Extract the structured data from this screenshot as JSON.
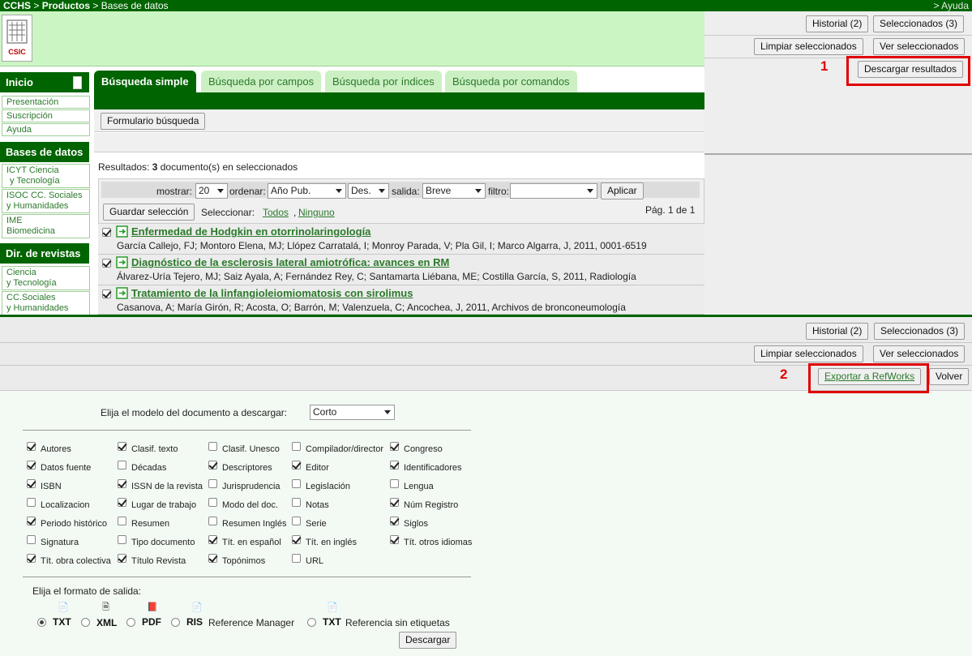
{
  "topbar": {
    "crumb_home": "CCHS",
    "crumb_sep1": ">",
    "crumb_products": "Productos",
    "crumb_sep2": ">",
    "crumb_db": "Bases de datos",
    "help": "> Ayuda"
  },
  "logo": {
    "text": "CSIC"
  },
  "top_buttons": {
    "historial": "Historial (2)",
    "seleccionados": "Seleccionados (3)",
    "limpiar": "Limpiar seleccionados",
    "ver": "Ver seleccionados",
    "descargar": "Descargar resultados"
  },
  "markers": {
    "one": "1",
    "two": "2"
  },
  "sidebar": {
    "inicio": "Inicio",
    "inicio_links": [
      "Presentación",
      "Suscripción",
      "Ayuda"
    ],
    "bases": "Bases de datos",
    "bases_links": [
      [
        "ICYT Ciencia",
        "y Tecnología"
      ],
      [
        "ISOC CC. Sociales",
        "y Humanidades"
      ],
      [
        "IME",
        "Biomedicina"
      ]
    ],
    "revistas": "Dir. de revistas",
    "revistas_links": [
      [
        "Ciencia",
        "y Tecnología"
      ],
      [
        "CC.Sociales",
        "y Humanidades"
      ]
    ]
  },
  "tabs": [
    "Búsqueda simple",
    "Búsqueda por campos",
    "Búsqueda por índices",
    "Búsqueda por comandos"
  ],
  "form_button": "Formulario búsqueda",
  "results": {
    "prefix": "Resultados:",
    "count": "3",
    "suffix": "documento(s) en seleccionados"
  },
  "controls": {
    "mostrar_label": "mostrar:",
    "mostrar_value": "20",
    "ordenar_label": "ordenar:",
    "ordenar_value": "Año Pub.",
    "order_dir": "Des.",
    "salida_label": "salida:",
    "salida_value": "Breve",
    "filtro_label": "filtro:",
    "filtro_value": "",
    "aplicar": "Aplicar",
    "guardar": "Guardar selección",
    "seleccionar": "Seleccionar:",
    "todos": "Todos",
    "ninguno": "Ninguno",
    "pagina": "Pág. 1 de 1"
  },
  "documents": [
    {
      "title": "Enfermedad de Hodgkin en otorrinolaringología",
      "authors": "García Callejo, FJ; Montoro Elena, MJ; Llópez Carratalá, I; Monroy Parada, V; Pla Gil, I; Marco Algarra, J,  2011,  0001-6519"
    },
    {
      "title": "Diagnóstico de la esclerosis lateral amiotrófica: avances en RM",
      "authors": "Álvarez-Uría Tejero, MJ; Saiz Ayala, A; Fernández Rey, C; Santamarta Liébana, ME; Costilla García, S,  2011,  Radiología"
    },
    {
      "title": "Tratamiento de la linfangioleiomiomatosis con sirolimus",
      "authors": "Casanova, A; María Girón, R; Acosta, O; Barrón, M; Valenzuela, C; Ancochea, J,  2011,  Archivos de bronconeumología"
    }
  ],
  "bottom_buttons": {
    "historial": "Historial (2)",
    "seleccionados": "Seleccionados (3)",
    "limpiar": "Limpiar seleccionados",
    "ver": "Ver seleccionados",
    "exportar": "Exportar a RefWorks",
    "volver": "Volver"
  },
  "download": {
    "model_label": "Elija el modelo del documento a descargar:",
    "model_value": "Corto",
    "fields": [
      [
        {
          "label": "Autores",
          "checked": true
        },
        {
          "label": "Clasif. texto",
          "checked": true
        },
        {
          "label": "Clasif. Unesco",
          "checked": false
        },
        {
          "label": "Compilador/director",
          "checked": false
        },
        {
          "label": "Congreso",
          "checked": true
        }
      ],
      [
        {
          "label": "Datos fuente",
          "checked": true
        },
        {
          "label": "Décadas",
          "checked": false
        },
        {
          "label": "Descriptores",
          "checked": true
        },
        {
          "label": "Editor",
          "checked": true
        },
        {
          "label": "Identificadores",
          "checked": true
        }
      ],
      [
        {
          "label": "ISBN",
          "checked": true
        },
        {
          "label": "ISSN de la revista",
          "checked": true
        },
        {
          "label": "Jurisprudencia",
          "checked": false
        },
        {
          "label": "Legislación",
          "checked": false
        },
        {
          "label": "Lengua",
          "checked": false
        }
      ],
      [
        {
          "label": "Localizacion",
          "checked": false
        },
        {
          "label": "Lugar de trabajo",
          "checked": true
        },
        {
          "label": "Modo del doc.",
          "checked": false
        },
        {
          "label": "Notas",
          "checked": false
        },
        {
          "label": "Núm Registro",
          "checked": true
        }
      ],
      [
        {
          "label": "Periodo histórico",
          "checked": true
        },
        {
          "label": "Resumen",
          "checked": false
        },
        {
          "label": "Resumen Inglés",
          "checked": false
        },
        {
          "label": "Serie",
          "checked": false
        },
        {
          "label": "Siglos",
          "checked": true
        }
      ],
      [
        {
          "label": "Signatura",
          "checked": false
        },
        {
          "label": "Tipo documento",
          "checked": false
        },
        {
          "label": "Tít. en español",
          "checked": true
        },
        {
          "label": "Tít. en inglés",
          "checked": true
        },
        {
          "label": "Tít. otros idiomas",
          "checked": true
        }
      ],
      [
        {
          "label": "Tít. obra colectiva",
          "checked": true
        },
        {
          "label": "Título Revista",
          "checked": true
        },
        {
          "label": "Topónimos",
          "checked": true
        },
        {
          "label": "URL",
          "checked": false
        }
      ]
    ],
    "format_label": "Elija el formato de salida:",
    "formats": [
      {
        "code": "TXT",
        "desc": "",
        "selected": true,
        "icon": "text-doc-icon"
      },
      {
        "code": "XML",
        "desc": "",
        "selected": false,
        "icon": "xml-doc-icon"
      },
      {
        "code": "PDF",
        "desc": "",
        "selected": false,
        "icon": "pdf-icon"
      },
      {
        "code": "RIS",
        "desc": "Reference Manager",
        "selected": false,
        "icon": "ris-doc-icon"
      },
      {
        "code": "TXT",
        "desc": "Referencia sin etiquetas",
        "selected": false,
        "icon": "text-doc-icon"
      }
    ],
    "submit": "Descargar"
  },
  "colors": {
    "dark_green": "#006400",
    "light_green": "#ccf5c4",
    "link_green": "#2b7a2b",
    "highlight_red": "#e00000"
  }
}
